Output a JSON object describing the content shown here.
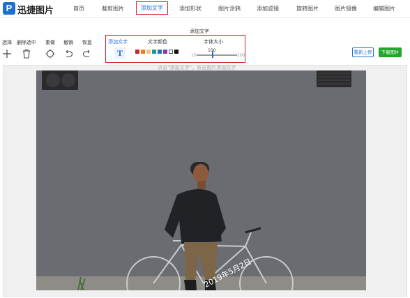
{
  "app": {
    "logo_letter": "P",
    "title": "迅捷图片"
  },
  "nav": {
    "items": [
      "首页",
      "裁剪图片",
      "添加文字",
      "添加形状",
      "图片涂鸦",
      "添加滤镜",
      "旋转图片",
      "图片镜像",
      "编辑图片"
    ],
    "active_index": 2
  },
  "toolbar": {
    "section_title": "添加文字",
    "tools": [
      "选择",
      "删除选中",
      "重做",
      "撤销",
      "恢复"
    ],
    "add_text_label": "添加文字",
    "add_text_glyph": "T",
    "color_label": "文字颜色",
    "colors": [
      "#d0262b",
      "#e8821f",
      "#e8c58c",
      "#1a9a8e",
      "#2a6fbf",
      "#7a3fb5",
      "#ffffff",
      "#111111"
    ],
    "font_size_label": "字体大小",
    "font_size_value": "100",
    "font_size_min": "10",
    "font_size_max": "200",
    "reupload_label": "重新上传",
    "download_label": "下载图片"
  },
  "canvas": {
    "hint": "点击“添加文字”，双击图片添加文字",
    "watermark_text": "2019年5月2日"
  }
}
